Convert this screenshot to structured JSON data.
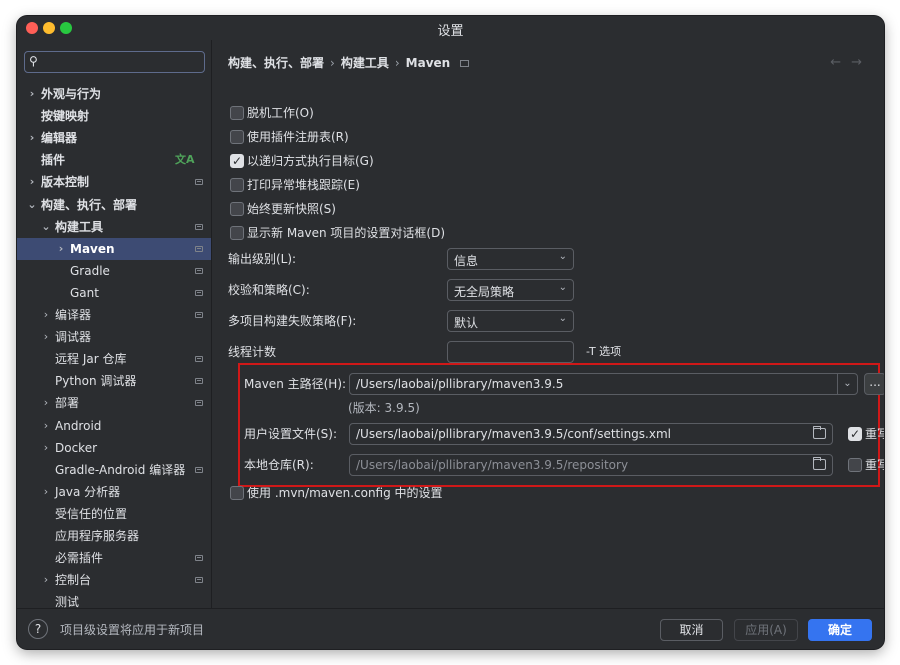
{
  "window": {
    "title": "设置"
  },
  "sidebar": {
    "search_placeholder": "",
    "items": [
      {
        "label": "外观与行为",
        "arrow": "›",
        "mark": false
      },
      {
        "label": "按键映射",
        "arrow": "",
        "mark": false
      },
      {
        "label": "编辑器",
        "arrow": "›",
        "mark": false
      },
      {
        "label": "插件",
        "arrow": "",
        "mark": false
      },
      {
        "label": "版本控制",
        "arrow": "›",
        "mark": true
      },
      {
        "label": "构建、执行、部署",
        "arrow": "⌄",
        "mark": false
      },
      {
        "label": "构建工具",
        "arrow": "⌄",
        "mark": true
      },
      {
        "label": "Maven",
        "arrow": "›",
        "mark": true
      },
      {
        "label": "Gradle",
        "arrow": "",
        "mark": true
      },
      {
        "label": "Gant",
        "arrow": "",
        "mark": true
      },
      {
        "label": "编译器",
        "arrow": "›",
        "mark": true
      },
      {
        "label": "调试器",
        "arrow": "›",
        "mark": false
      },
      {
        "label": "远程 Jar 仓库",
        "arrow": "",
        "mark": true
      },
      {
        "label": "Python 调试器",
        "arrow": "",
        "mark": true
      },
      {
        "label": "部署",
        "arrow": "›",
        "mark": true
      },
      {
        "label": "Android",
        "arrow": "›",
        "mark": false
      },
      {
        "label": "Docker",
        "arrow": "›",
        "mark": false
      },
      {
        "label": "Gradle-Android 编译器",
        "arrow": "",
        "mark": true
      },
      {
        "label": "Java 分析器",
        "arrow": "›",
        "mark": false
      },
      {
        "label": "受信任的位置",
        "arrow": "",
        "mark": false
      },
      {
        "label": "应用程序服务器",
        "arrow": "",
        "mark": false
      },
      {
        "label": "必需插件",
        "arrow": "",
        "mark": true
      },
      {
        "label": "控制台",
        "arrow": "›",
        "mark": true
      },
      {
        "label": "测试",
        "arrow": "",
        "mark": false
      }
    ]
  },
  "breadcrumb": {
    "part1": "构建、执行、部署",
    "part2": "构建工具",
    "part3": "Maven",
    "sep": "›"
  },
  "nav": {
    "back": "←",
    "forward": "→"
  },
  "options": {
    "offline": "脱机工作(O)",
    "plugin_registry": "使用插件注册表(R)",
    "recursive": "以递归方式执行目标(G)",
    "print_stack": "打印异常堆栈跟踪(E)",
    "always_update": "始终更新快照(S)",
    "show_dialog": "显示新 Maven 项目的设置对话框(D)",
    "use_mvn_config": "使用 .mvn/maven.config 中的设置"
  },
  "fields": {
    "output_level_label": "输出级别(L):",
    "output_level_value": "信息",
    "checksum_label": "校验和策略(C):",
    "checksum_value": "无全局策略",
    "failure_label": "多项目构建失败策略(F):",
    "failure_value": "默认",
    "threads_label": "线程计数",
    "threads_hint": "-T 选项",
    "maven_home_label": "Maven 主路径(H):",
    "maven_home_value": "/Users/laobai/pllibrary/maven3.9.5",
    "browse_label": "...",
    "version": "(版本: 3.9.5)",
    "user_settings_label": "用户设置文件(S):",
    "user_settings_value": "/Users/laobai/pllibrary/maven3.9.5/conf/settings.xml",
    "override_label": "重写",
    "local_repo_label": "本地仓库(R):",
    "local_repo_value": "/Users/laobai/pllibrary/maven3.9.5/repository",
    "override_label2": "重写"
  },
  "footer": {
    "help": "?",
    "note": "项目级设置将应用于新项目",
    "cancel": "取消",
    "apply": "应用(A)",
    "ok": "确定"
  },
  "colors": {
    "accent": "#3574f0",
    "selection": "#3d4b73",
    "highlight_box": "#d01818"
  }
}
